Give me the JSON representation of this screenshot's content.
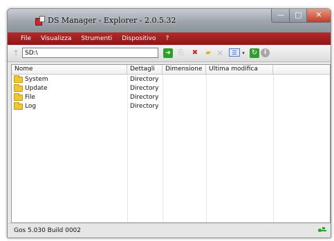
{
  "window": {
    "title": "DS Manager - Explorer - 2.0.5.32",
    "controls": {
      "minimize": "—",
      "maximize": "□",
      "close": "✕"
    }
  },
  "menu": [
    "File",
    "Visualizza",
    "Strumenti",
    "Dispositivo",
    "?"
  ],
  "toolbar": {
    "path": "SD:\\",
    "icons": [
      "up-arrow-icon",
      "go-arrow-icon",
      "copy-icon",
      "delete-device-icon",
      "new-folder-icon",
      "delete-icon",
      "view-icon",
      "refresh-icon",
      "info-icon"
    ]
  },
  "list": {
    "columns": [
      "Nome",
      "Dettagli",
      "Dimensione",
      "Ultima modifica"
    ],
    "rows": [
      {
        "name": "System",
        "details": "Directory",
        "size": "",
        "modified": ""
      },
      {
        "name": "Update",
        "details": "Directory",
        "size": "",
        "modified": ""
      },
      {
        "name": "File",
        "details": "Directory",
        "size": "",
        "modified": ""
      },
      {
        "name": "Log",
        "details": "Directory",
        "size": "",
        "modified": ""
      }
    ]
  },
  "status": {
    "text": "Gos 5.030 Build 0002"
  },
  "colors": {
    "menubar": "#a82020",
    "titlebar": "#9ea4ab",
    "close": "#c43c26",
    "folder": "#f2c534",
    "usb": "#2aa02a"
  }
}
